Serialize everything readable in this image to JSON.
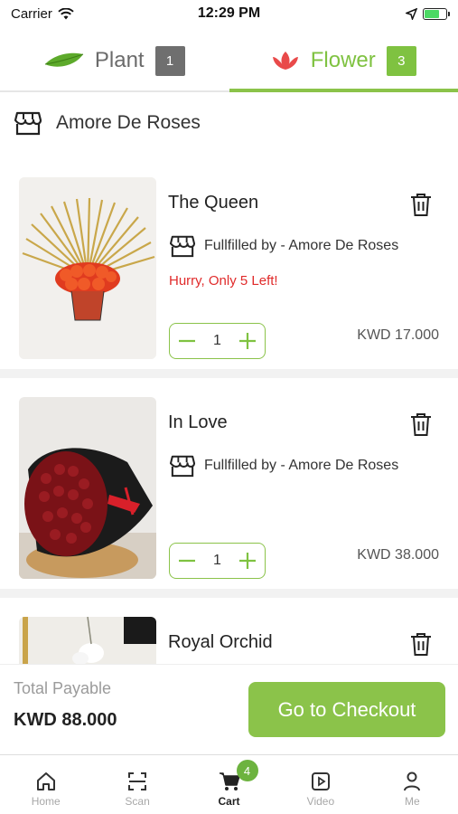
{
  "status_bar": {
    "carrier": "Carrier",
    "time": "12:29 PM"
  },
  "tabs": [
    {
      "label": "Plant",
      "count": "1"
    },
    {
      "label": "Flower",
      "count": "3"
    }
  ],
  "store": {
    "name": "Amore De Roses"
  },
  "items": [
    {
      "title": "The Queen",
      "vendor": "Fullfilled by - Amore De Roses",
      "hurry": "Hurry, Only 5 Left!",
      "quantity": "1",
      "price": "KWD 17.000"
    },
    {
      "title": "In Love",
      "vendor": "Fullfilled by - Amore De Roses",
      "quantity": "1",
      "price": "KWD 38.000"
    },
    {
      "title": "Royal Orchid"
    }
  ],
  "checkout": {
    "total_label": "Total Payable",
    "total_value": "KWD 88.000",
    "button_label": "Go to Checkout"
  },
  "bottom_nav": [
    {
      "label": "Home",
      "icon": "home-icon"
    },
    {
      "label": "Scan",
      "icon": "scan-icon"
    },
    {
      "label": "Cart",
      "icon": "cart-icon",
      "badge": "4",
      "active": true
    },
    {
      "label": "Video",
      "icon": "video-icon"
    },
    {
      "label": "Me",
      "icon": "person-icon"
    }
  ],
  "colors": {
    "accent": "#8bc34a",
    "warning": "#e02a2a",
    "inactive": "#6f6f6f"
  }
}
